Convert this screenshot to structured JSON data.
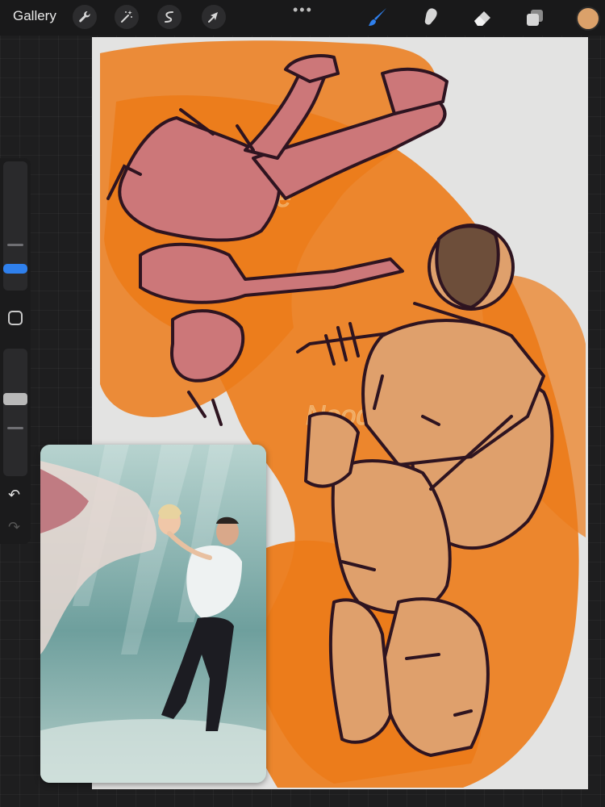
{
  "toolbar": {
    "gallery_label": "Gallery",
    "left_tools": [
      "wrench-icon",
      "magic-wand-icon",
      "selection-icon",
      "transform-arrow-icon"
    ],
    "right_tools": [
      "brush-icon",
      "smudge-icon",
      "eraser-icon",
      "layers-icon"
    ],
    "active_tool": "brush-icon",
    "accent_color": "#2f80ed",
    "current_color": "#dba16a",
    "more_label": "•••"
  },
  "sidebar": {
    "undo_label": "↶",
    "redo_label": "↷"
  },
  "canvas": {
    "watermark": "NoodleCake",
    "orange_color": "#ec7b1a",
    "pink_figure_color": "#cc7779",
    "astronaut_color": "#dfa06c",
    "line_color": "#2e1420"
  }
}
